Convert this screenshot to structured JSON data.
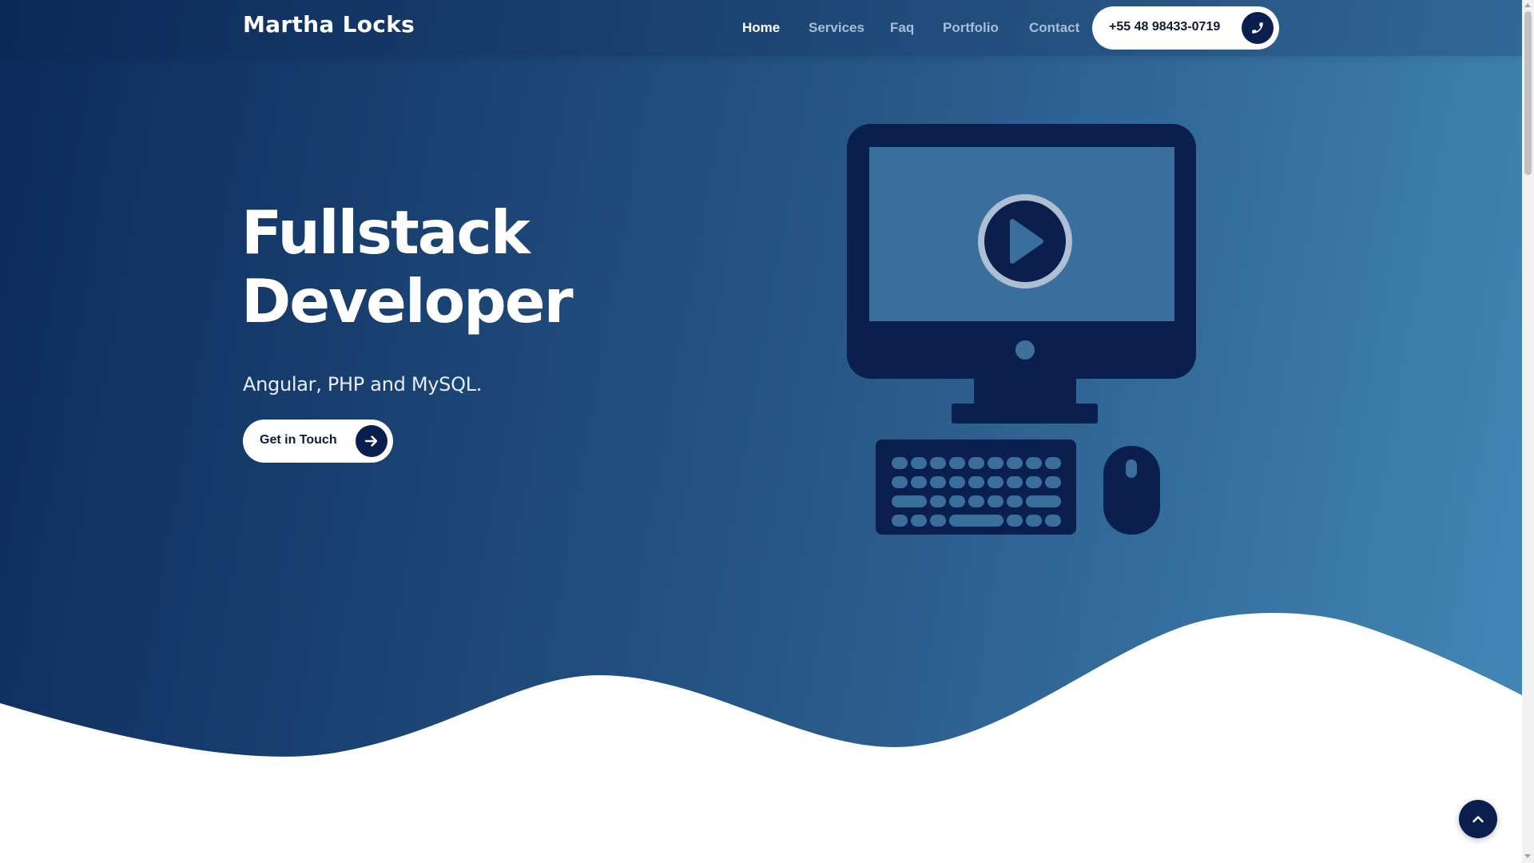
{
  "brand": {
    "name": "Martha Locks"
  },
  "nav": {
    "items": [
      {
        "label": "Home",
        "active": true
      },
      {
        "label": "Services",
        "active": false
      },
      {
        "label": "Faq",
        "active": false
      },
      {
        "label": "Portfolio",
        "active": false
      },
      {
        "label": "Contact",
        "active": false
      }
    ],
    "phone": {
      "number": "+55 48 98433-0719",
      "icon": "phone-icon"
    }
  },
  "hero": {
    "title_line1": "Fullstack",
    "title_line2": "Developer",
    "subtitle": "Angular, PHP and MySQL.",
    "cta": {
      "label": "Get in Touch",
      "icon": "arrow-right-icon"
    },
    "illustration": "desktop-computer-with-play-button-illustration"
  },
  "scroll_top": {
    "icon": "chevron-up-icon"
  },
  "colors": {
    "hero_gradient_start": "#0d2a5c",
    "hero_gradient_end": "#4387b6",
    "accent_dark": "#0a1f4d",
    "illustration_screen": "#3a6e9c",
    "white": "#ffffff"
  }
}
